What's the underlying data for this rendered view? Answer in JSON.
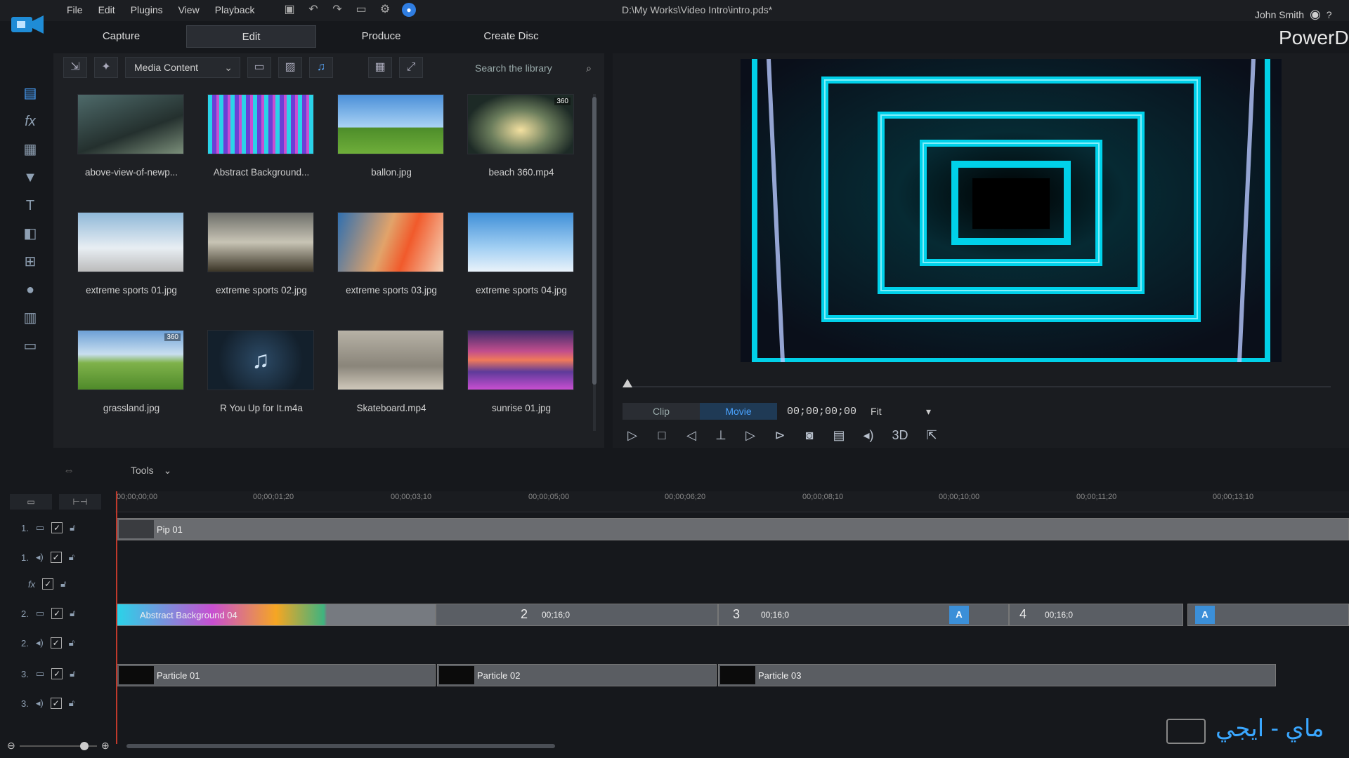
{
  "menu": [
    "File",
    "Edit",
    "Plugins",
    "View",
    "Playback"
  ],
  "file_path": "D:\\My Works\\Video Intro\\intro.pds*",
  "user_name": "John Smith",
  "brand": "PowerDi",
  "mode_tabs": [
    "Capture",
    "Edit",
    "Produce",
    "Create Disc"
  ],
  "library": {
    "content_select": "Media Content",
    "search_placeholder": "Search the library",
    "items": [
      {
        "label": "above-view-of-newp..."
      },
      {
        "label": "Abstract Background..."
      },
      {
        "label": "ballon.jpg"
      },
      {
        "label": "beach 360.mp4",
        "badge": "360"
      },
      {
        "label": "extreme sports 01.jpg"
      },
      {
        "label": "extreme sports 02.jpg"
      },
      {
        "label": "extreme sports 03.jpg"
      },
      {
        "label": "extreme sports 04.jpg"
      },
      {
        "label": "grassland.jpg",
        "badge": "360"
      },
      {
        "label": "R You Up for It.m4a"
      },
      {
        "label": "Skateboard.mp4"
      },
      {
        "label": "sunrise 01.jpg"
      }
    ]
  },
  "preview": {
    "seg_clip": "Clip",
    "seg_movie": "Movie",
    "timecode": "00;00;00;00",
    "fit": "Fit",
    "threed": "3D"
  },
  "timeline": {
    "tools_label": "Tools",
    "ruler_ticks": [
      "00;00;00;00",
      "00;00;01;20",
      "00;00;03;10",
      "00;00;05;00",
      "00;00;06;20",
      "00;00;08;10",
      "00;00;10;00",
      "00;00;11;20",
      "00;00;13;10"
    ],
    "track_numbers": [
      "1.",
      "1.",
      "",
      "2.",
      "2.",
      "3.",
      "3."
    ],
    "clips": {
      "pip": "Pip 01",
      "abstract": "Abstract Background 04",
      "seg2": "2",
      "seg2_time": "00;16;0",
      "seg3": "3",
      "seg3_time": "00;16;0",
      "seg4": "4",
      "seg4_time": "00;16;0",
      "particle_a": "Particle 01",
      "particle_b": "Particle 02",
      "particle_c": "Particle 03"
    }
  },
  "watermark": "ماي - ايجي",
  "colors": {
    "accent": "#4aa3ff",
    "playhead": "#c0392b",
    "neon": "#00e5ff"
  }
}
